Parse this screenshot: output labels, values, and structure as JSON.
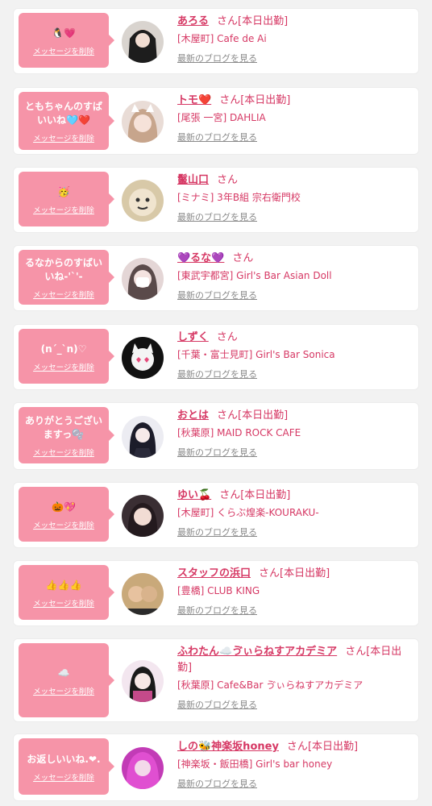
{
  "cards": [
    {
      "message": "🐧💗",
      "delete_label": "メッセージを削除",
      "name": "あろる",
      "san": "さん",
      "status": "[本日出勤]",
      "shop": "[木屋町] Cafe de Ai",
      "blog_label": "最新のブログを見る"
    },
    {
      "message": "ともちゃんのすばいいね🩵❤️",
      "delete_label": "メッセージを削除",
      "name": "トモ❤️",
      "san": "さん",
      "status": "[本日出勤]",
      "shop": "[尾張 一宮] DAHLIA",
      "blog_label": "最新のブログを見る"
    },
    {
      "message": "🥳",
      "delete_label": "メッセージを削除",
      "name": "鬣山口",
      "san": "さん",
      "status": "",
      "shop": "[ミナミ] 3年B組 宗右衛門校",
      "blog_label": "最新のブログを見る"
    },
    {
      "message": "るなからのすばいいね-'`'-",
      "delete_label": "メッセージを削除",
      "name": "💜るな💜",
      "san": "さん",
      "status": "",
      "shop": "[東武宇都宮] Girl's Bar Asian Doll",
      "blog_label": "最新のブログを見る"
    },
    {
      "message": "(n´_`n)♡",
      "delete_label": "メッセージを削除",
      "name": "しずく",
      "san": "さん",
      "status": "",
      "shop": "[千葉・富士見町] Girl's Bar Sonica",
      "blog_label": "最新のブログを見る"
    },
    {
      "message": "ありがとうございますっ🫧",
      "delete_label": "メッセージを削除",
      "name": "おとは",
      "san": "さん",
      "status": "[本日出勤]",
      "shop": "[秋葉原] MAID ROCK CAFE",
      "blog_label": "最新のブログを見る"
    },
    {
      "message": "🎃💖",
      "delete_label": "メッセージを削除",
      "name": "ゆい🍒",
      "san": "さん",
      "status": "[本日出勤]",
      "shop": "[木屋町] くらぶ煌楽-KOURAKU-",
      "blog_label": "最新のブログを見る"
    },
    {
      "message": "👍👍👍",
      "delete_label": "メッセージを削除",
      "name": "スタッフの浜口",
      "san": "さん",
      "status": "[本日出勤]",
      "shop": "[豊橋] CLUB KING",
      "blog_label": "最新のブログを見る"
    },
    {
      "message": "☁️",
      "delete_label": "メッセージを削除",
      "name": "ふわたん☁️ゔぃらねすアカデミア",
      "san": "さん",
      "status": "[本日出勤]",
      "shop": "[秋葉原] Cafe&Bar ゔぃらねすアカデミア",
      "blog_label": "最新のブログを見る"
    },
    {
      "message": "お返しいいね.❤︎.",
      "delete_label": "メッセージを削除",
      "name": "しの🐝神楽坂honey",
      "san": "さん",
      "status": "[本日出勤]",
      "shop": "[神楽坂・飯田橋] Girl's bar honey",
      "blog_label": "最新のブログを見る"
    }
  ]
}
